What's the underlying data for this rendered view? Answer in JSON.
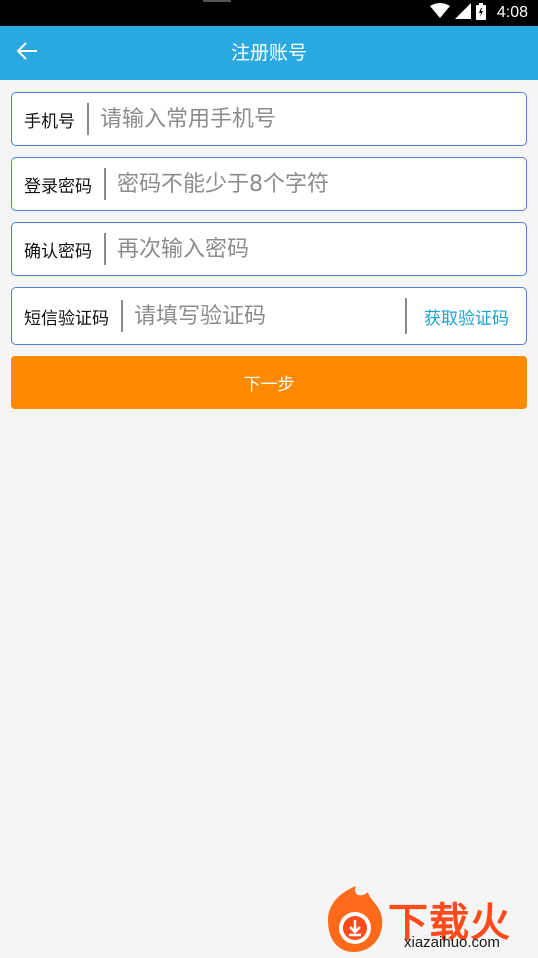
{
  "status_bar": {
    "time": "4:08",
    "icons": [
      "wifi-icon",
      "signal-icon",
      "battery-icon"
    ]
  },
  "app_bar": {
    "title": "注册账号",
    "back_icon": "arrow-left-icon",
    "color": "#2aa9e0"
  },
  "form": {
    "phone": {
      "label": "手机号",
      "placeholder": "请输入常用手机号",
      "value": ""
    },
    "password": {
      "label": "登录密码",
      "placeholder": "密码不能少于8个字符",
      "value": ""
    },
    "confirm": {
      "label": "确认密码",
      "placeholder": "再次输入密码",
      "value": ""
    },
    "sms": {
      "label": "短信验证码",
      "placeholder": "请填写验证码",
      "value": "",
      "get_code_label": "获取验证码"
    }
  },
  "next_button": {
    "label": "下一步",
    "color": "#ff8a00"
  },
  "watermark": {
    "title": "下载火",
    "url": "xiazaihuo.com"
  }
}
